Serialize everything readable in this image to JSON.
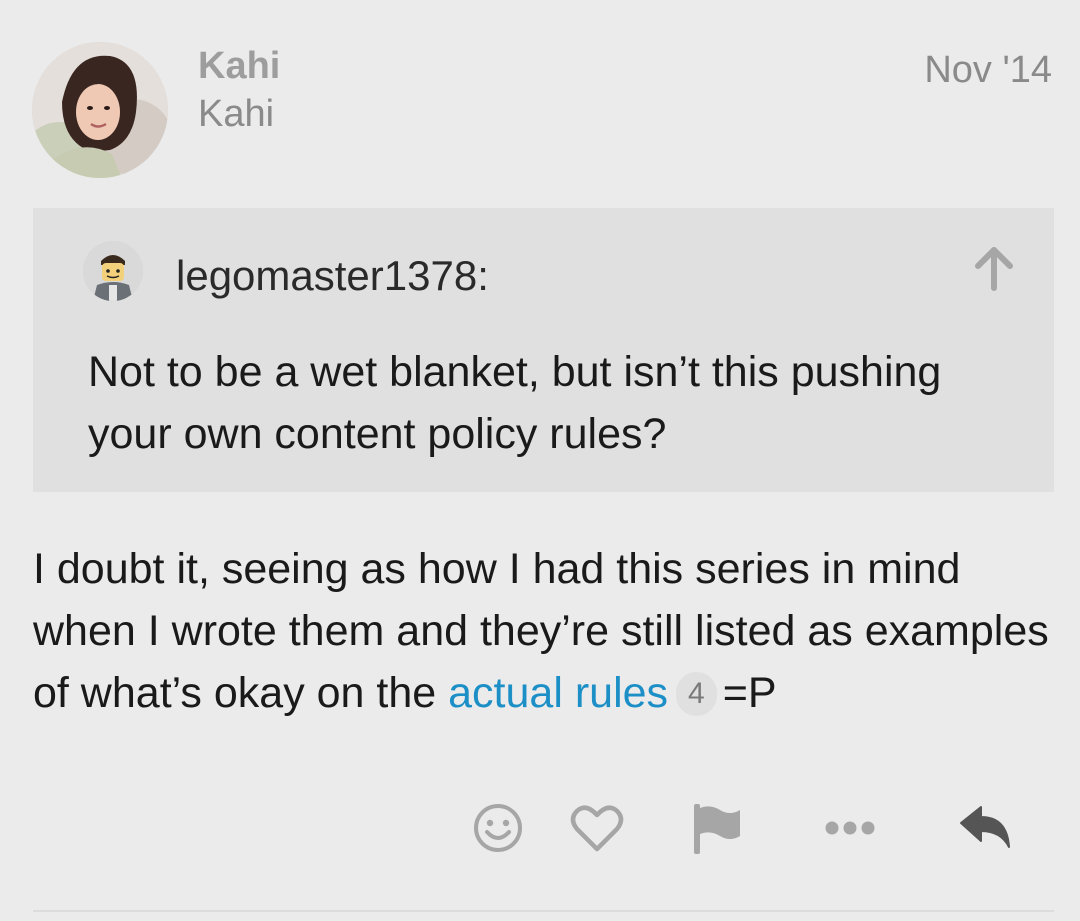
{
  "post": {
    "username": "Kahi",
    "display_name": "Kahi",
    "date": "Nov '14",
    "avatar_icon": "user-avatar-photo"
  },
  "quote": {
    "author": "legomaster1378:",
    "text": "Not to be a wet blanket, but isn’t this pushing your own content policy rules?",
    "avatar_icon": "lego-minifigure-avatar",
    "jump_icon": "arrow-up-icon"
  },
  "body": {
    "text_before_link": "I doubt it, seeing as how I had this series in mind when I wrote them and they’re still listed as examples of what’s okay on the ",
    "link_text": "actual rules",
    "link_clicks": "4",
    "text_after_link": "=P"
  },
  "actions": [
    {
      "name": "react-button",
      "icon": "smiley-icon"
    },
    {
      "name": "like-button",
      "icon": "heart-icon"
    },
    {
      "name": "flag-button",
      "icon": "flag-icon"
    },
    {
      "name": "more-button",
      "icon": "ellipsis-icon"
    },
    {
      "name": "reply-button",
      "icon": "reply-arrow-icon"
    }
  ],
  "colors": {
    "background": "#ebebeb",
    "quote_background": "#e0e0e0",
    "link": "#1d8fc7",
    "icon": "#a6a6a6",
    "reply_icon": "#555555"
  }
}
